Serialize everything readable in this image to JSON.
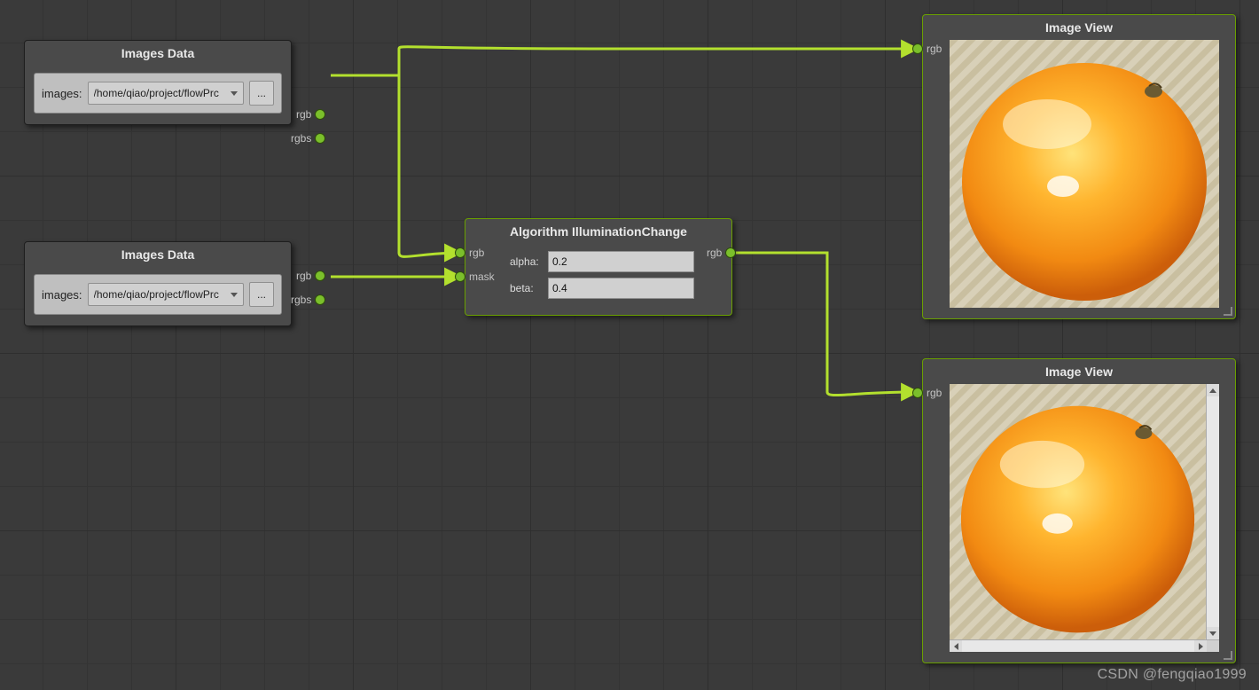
{
  "watermark": "CSDN @fengqiao1999",
  "nodes": {
    "imagesData1": {
      "title": "Images Data",
      "images_label": "images:",
      "path_value": "/home/qiao/project/flowPrc",
      "browse_label": "...",
      "ports": {
        "rgb": "rgb",
        "rgbs": "rgbs"
      }
    },
    "imagesData2": {
      "title": "Images Data",
      "images_label": "images:",
      "path_value": "/home/qiao/project/flowPrc",
      "browse_label": "...",
      "ports": {
        "rgb": "rgb",
        "rgbs": "rgbs"
      }
    },
    "algorithm": {
      "title": "Algorithm IlluminationChange",
      "alpha_label": "alpha:",
      "alpha_value": "0.2",
      "beta_label": "beta:",
      "beta_value": "0.4",
      "ports": {
        "in_rgb": "rgb",
        "in_mask": "mask",
        "out_rgb": "rgb"
      }
    },
    "imageView1": {
      "title": "Image View",
      "ports": {
        "in_rgb": "rgb"
      }
    },
    "imageView2": {
      "title": "Image View",
      "ports": {
        "in_rgb": "rgb"
      }
    }
  },
  "connections": [
    {
      "from": "imagesData1.rgb",
      "to": "algorithm.in_rgb"
    },
    {
      "from": "imagesData1.rgb",
      "to": "imageView1.in_rgb"
    },
    {
      "from": "imagesData2.rgb",
      "to": "algorithm.in_mask"
    },
    {
      "from": "algorithm.out_rgb",
      "to": "imageView2.in_rgb"
    }
  ]
}
